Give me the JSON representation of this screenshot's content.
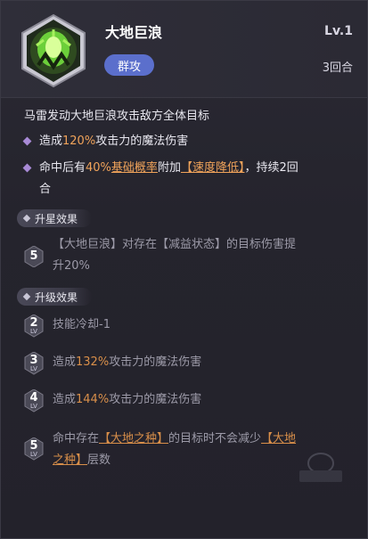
{
  "skill": {
    "name": "大地巨浪",
    "level": "Lv.1",
    "tag": "群攻",
    "cooldown": "3回合",
    "description": "马雷发动大地巨浪攻击敌方全体目标"
  },
  "effects": [
    {
      "prefix": "造成",
      "value": "120%",
      "suffix": "攻击力的魔法伤害"
    },
    {
      "prefix": "命中后有",
      "value": "40%",
      "link": "基础概率",
      "mid": "附加",
      "status": "【速度降低】",
      "tail": "，持续2回",
      "tail2": "合"
    }
  ],
  "star_section": {
    "label": "升星效果",
    "badge": "5",
    "text_a": "【大地巨浪】对存在【减益状态】的目标伤害提",
    "text_b": "升20%"
  },
  "upgrade_section": {
    "label": "升级效果",
    "items": [
      {
        "num": "2",
        "lv": "LV",
        "prefix": "技能冷却-1",
        "value": "",
        "suffix": ""
      },
      {
        "num": "3",
        "lv": "LV",
        "prefix": "造成",
        "value": "132%",
        "suffix": "攻击力的魔法伤害"
      },
      {
        "num": "4",
        "lv": "LV",
        "prefix": "造成",
        "value": "144%",
        "suffix": "攻击力的魔法伤害"
      }
    ],
    "last": {
      "num": "5",
      "lv": "LV",
      "prefix": "命中存在",
      "seed1": "【大地之种】",
      "mid": "的目标时不会减少",
      "seed2a": "【大地",
      "seed2b": "之种】",
      "tail": "层数"
    }
  },
  "colors": {
    "accent": "#f0a35a",
    "tag": "#5b6fcc",
    "diamond": "#a88ad6"
  }
}
